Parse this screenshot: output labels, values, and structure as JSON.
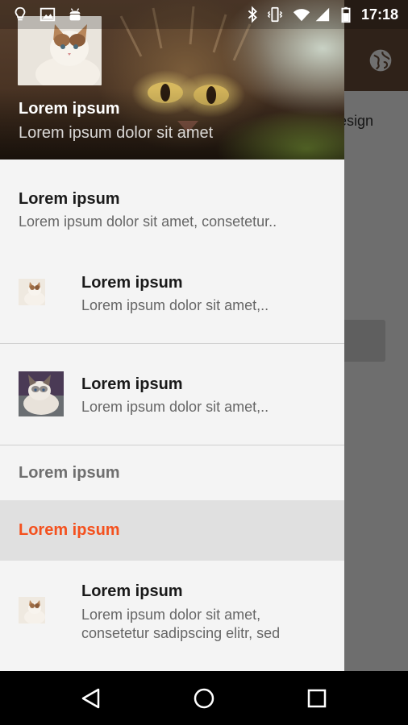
{
  "status_bar": {
    "time": "17:18",
    "left_icons": [
      "lightbulb-icon",
      "image-icon",
      "android-icon"
    ],
    "right_icons": [
      "bluetooth-icon",
      "vibrate-icon",
      "wifi-icon",
      "signal-icon",
      "battery-icon"
    ]
  },
  "app_behind": {
    "toolbar_icon": "globe-icon",
    "visible_text": "esign"
  },
  "drawer": {
    "header": {
      "title": "Lorem ipsum",
      "subtitle": "Lorem ipsum dolor sit amet"
    },
    "items": [
      {
        "title": "Lorem ipsum",
        "subtitle": "Lorem ipsum dolor sit amet, consetetur.."
      },
      {
        "title": "Lorem ipsum",
        "subtitle": "Lorem ipsum dolor sit amet,.."
      },
      {
        "title": "Lorem ipsum",
        "subtitle": "Lorem ipsum dolor sit amet,.."
      },
      {
        "label": "Lorem ipsum"
      },
      {
        "label": "Lorem ipsum",
        "selected": true
      },
      {
        "title": "Lorem ipsum",
        "subtitle_line1": "Lorem ipsum dolor sit amet,",
        "subtitle_line2": "consetetur sadipscing elitr, sed"
      }
    ],
    "accent_color": "#f4511e"
  },
  "nav_bar": {
    "buttons": [
      "back-icon",
      "home-icon",
      "recents-icon"
    ]
  }
}
